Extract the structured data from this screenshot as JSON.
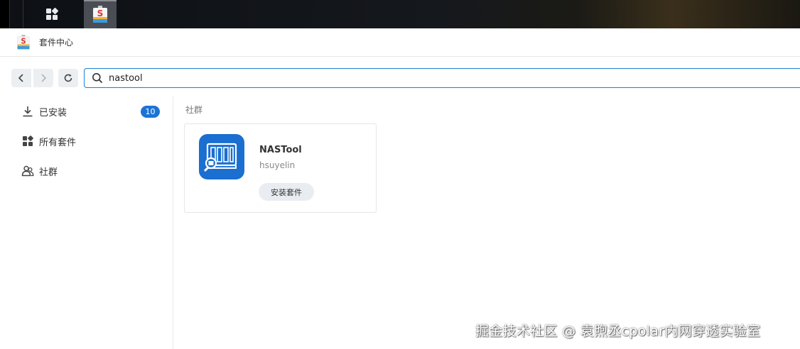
{
  "taskbar": {
    "menu_icon": "grid-menu-icon",
    "app_icon": "package-center-icon"
  },
  "window": {
    "title": "套件中心",
    "logo_icon": "package-center-icon"
  },
  "toolbar": {
    "back_icon": "chevron-left-icon",
    "forward_icon": "chevron-right-icon",
    "refresh_icon": "refresh-icon",
    "search": {
      "icon": "search-icon",
      "value": "nastool"
    }
  },
  "sidebar": {
    "items": [
      {
        "label": "已安装",
        "icon": "download-icon",
        "badge": "10"
      },
      {
        "label": "所有套件",
        "icon": "grid-icon"
      },
      {
        "label": "社群",
        "icon": "community-icon"
      }
    ]
  },
  "main": {
    "section_label": "社群",
    "packages": [
      {
        "name": "NASTool",
        "author": "hsuyelin",
        "icon": "nas-tool-app-icon",
        "install_label": "安装套件"
      }
    ]
  },
  "watermark": "掘金技术社区 @ 袁煦丞cpolar内网穿透实验室"
}
